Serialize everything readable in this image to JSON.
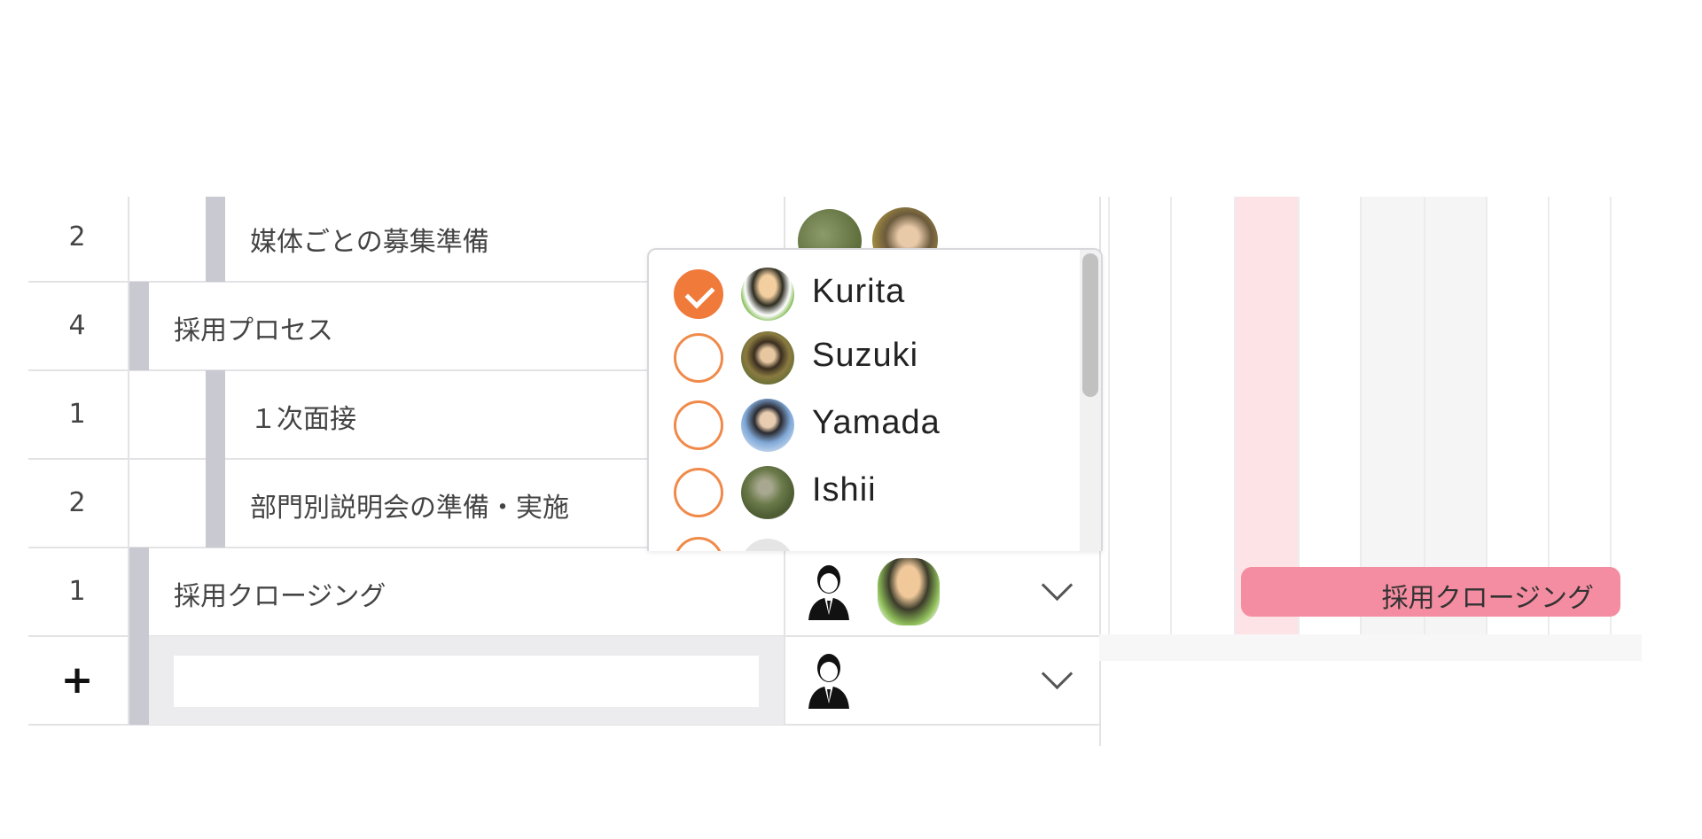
{
  "rows": [
    {
      "count": "2",
      "name": "媒体ごとの募集準備"
    },
    {
      "count": "4",
      "name": "採用プロセス"
    },
    {
      "count": "1",
      "name": "１次面接"
    },
    {
      "count": "2",
      "name": "部門別説明会の準備・実施"
    },
    {
      "count": "1",
      "name": "採用クロージング"
    }
  ],
  "add_row": {
    "symbol": "+",
    "input_value": "",
    "input_placeholder": ""
  },
  "assignee_popup": {
    "options": [
      {
        "name": "Kurita",
        "checked": true
      },
      {
        "name": "Suzuki",
        "checked": false
      },
      {
        "name": "Yamada",
        "checked": false
      },
      {
        "name": "Ishii",
        "checked": false
      }
    ]
  },
  "gantt": {
    "bar_label": "採用クロージング"
  },
  "colors": {
    "accent": "#f07a3a",
    "gantt_bar": "#f58da2",
    "highlight_column": "#fde3e6",
    "weekend_column": "#f5f5f5",
    "indent_bar": "#c8c9d1"
  },
  "icons": {
    "chevron": "chevron-down-icon",
    "person": "person-icon",
    "check": "checkmark-icon"
  }
}
